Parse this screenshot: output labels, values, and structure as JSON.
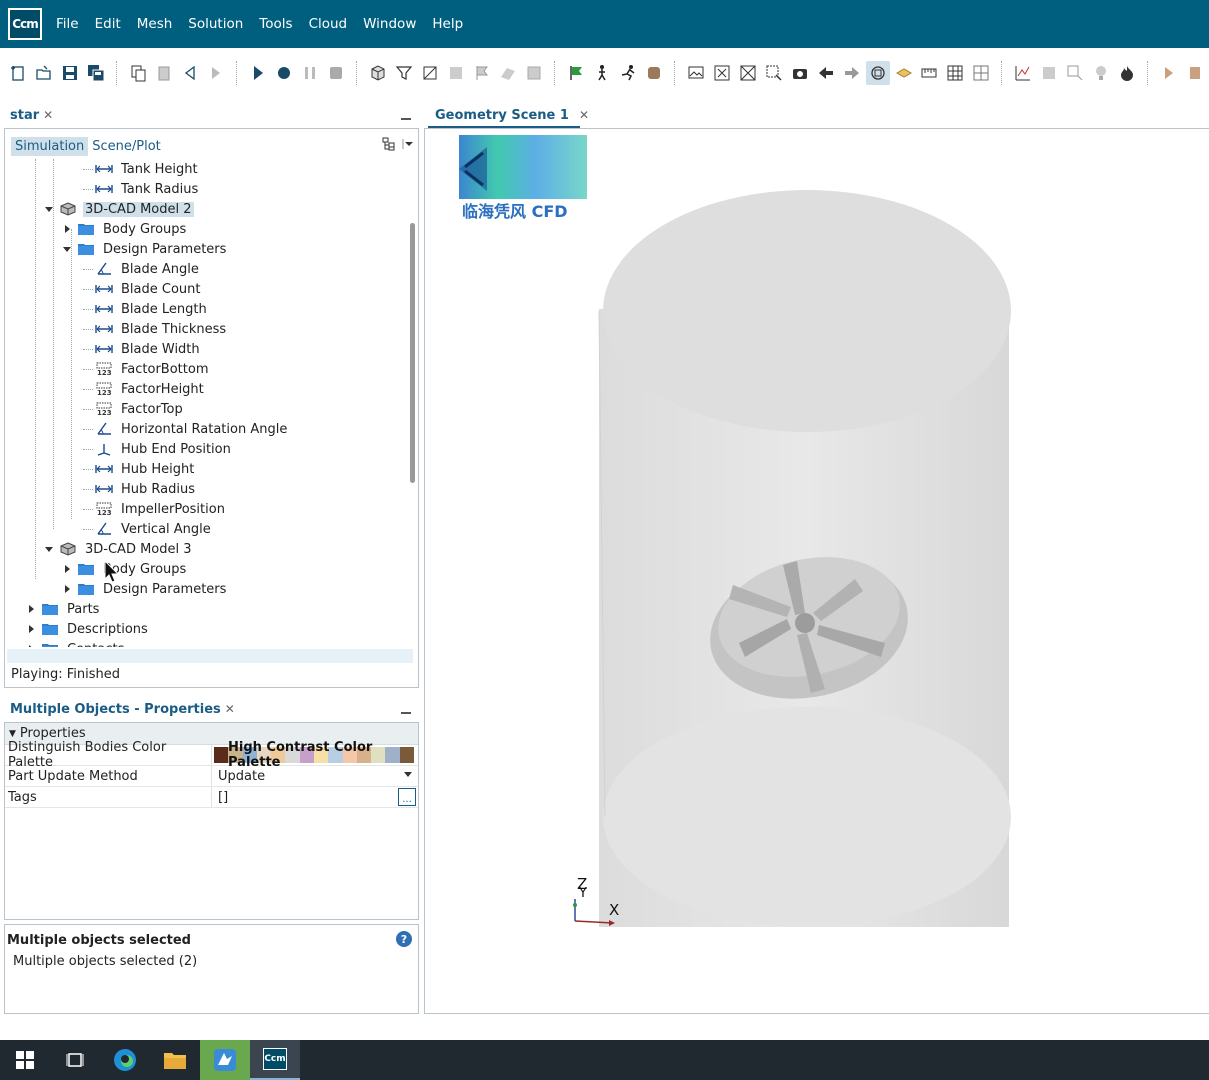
{
  "menubar": {
    "app_icon": "ccm-logo",
    "app_logo_text": "Ccm",
    "items": [
      "File",
      "Edit",
      "Mesh",
      "Solution",
      "Tools",
      "Cloud",
      "Window",
      "Help"
    ]
  },
  "toolbar": {
    "groups": [
      [
        "new-sim-icon",
        "open-icon",
        "save-icon",
        "save-all-icon"
      ],
      [
        "copy-icon",
        "clipboard-icon",
        "step-back-icon",
        "step-forward-icon"
      ],
      [
        "run-icon",
        "step-icon",
        "pause-icon",
        "stop-icon"
      ],
      [
        "mesh-icon",
        "filter-icon",
        "geometry-icon",
        "grid-icon",
        "flag-icon",
        "surface-icon",
        "volume-icon"
      ],
      [
        "green-flag-icon",
        "walk-icon",
        "run-man-icon",
        "cylinder-icon"
      ],
      [
        "screenshot-icon",
        "fit-icon",
        "zoom-icon",
        "select-icon",
        "camera-icon",
        "back-arrow-icon",
        "forward-arrow-icon",
        "transparency-icon",
        "plane-icon",
        "ruler-icon",
        "table-icon",
        "layout-icon"
      ],
      [
        "plot-icon",
        "pan-icon",
        "crop-icon",
        "bulb-icon",
        "fire-icon"
      ],
      [
        "play-icon",
        "more-icon"
      ]
    ]
  },
  "tree_panel": {
    "tab_title": "star",
    "subtabs": [
      "Simulation",
      "Scene/Plot"
    ],
    "active_subtab": "Simulation",
    "rows": [
      {
        "label": "Tank Height",
        "icon": "length-param-icon",
        "depth": 3
      },
      {
        "label": "Tank Radius",
        "icon": "length-param-icon",
        "depth": 3
      },
      {
        "label": "3D-CAD Model 2",
        "icon": "cad-model-icon",
        "depth": 1,
        "expanded": true,
        "highlight": true
      },
      {
        "label": "Body Groups",
        "icon": "folder-icon",
        "depth": 2,
        "expanded": false
      },
      {
        "label": "Design Parameters",
        "icon": "folder-icon",
        "depth": 2,
        "expanded": true
      },
      {
        "label": "Blade Angle",
        "icon": "angle-param-icon",
        "depth": 3
      },
      {
        "label": "Blade Count",
        "icon": "length-param-icon",
        "depth": 3
      },
      {
        "label": "Blade Length",
        "icon": "length-param-icon",
        "depth": 3
      },
      {
        "label": "Blade Thickness",
        "icon": "length-param-icon",
        "depth": 3
      },
      {
        "label": "Blade Width",
        "icon": "length-param-icon",
        "depth": 3
      },
      {
        "label": "FactorBottom",
        "icon": "number-param-icon",
        "depth": 3
      },
      {
        "label": "FactorHeight",
        "icon": "number-param-icon",
        "depth": 3
      },
      {
        "label": "FactorTop",
        "icon": "number-param-icon",
        "depth": 3
      },
      {
        "label": "Horizontal Ratation Angle",
        "icon": "angle-param-icon",
        "depth": 3
      },
      {
        "label": "Hub End Position",
        "icon": "vector-param-icon",
        "depth": 3
      },
      {
        "label": "Hub Height",
        "icon": "length-param-icon",
        "depth": 3
      },
      {
        "label": "Hub Radius",
        "icon": "length-param-icon",
        "depth": 3
      },
      {
        "label": "ImpellerPosition",
        "icon": "number-param-icon",
        "depth": 3
      },
      {
        "label": "Vertical Angle",
        "icon": "angle-param-icon",
        "depth": 3
      },
      {
        "label": "3D-CAD Model 3",
        "icon": "cad-model-icon",
        "depth": 1,
        "expanded": true
      },
      {
        "label": "Body Groups",
        "icon": "folder-icon",
        "depth": 2,
        "expanded": false
      },
      {
        "label": "Design Parameters",
        "icon": "folder-icon",
        "depth": 2,
        "expanded": false
      },
      {
        "label": "Parts",
        "icon": "folder-icon",
        "depth": 0,
        "expanded": false
      },
      {
        "label": "Descriptions",
        "icon": "folder-icon",
        "depth": 0,
        "expanded": false
      },
      {
        "label": "Contacts",
        "icon": "folder-icon",
        "depth": 0,
        "expanded": false
      }
    ],
    "status": "Playing: Finished"
  },
  "properties_panel": {
    "tab_title": "Multiple Objects - Properties",
    "section": "Properties",
    "rows": [
      {
        "name": "Distinguish Bodies Color Palette",
        "value": "High Contrast Color Palette",
        "kind": "palette"
      },
      {
        "name": "Part Update Method",
        "value": "Update",
        "kind": "dropdown"
      },
      {
        "name": "Tags",
        "value": "[]",
        "kind": "dots"
      }
    ],
    "palette_colors": [
      "#5a2a1a",
      "#c9b38a",
      "#8fb2d9",
      "#e8d6c0",
      "#f0c99a",
      "#d9d9d9",
      "#c7a0c9",
      "#f6e0a6",
      "#b8cfe3",
      "#f5c6a8",
      "#d6b18a",
      "#e0e0c0",
      "#9fb1c9",
      "#7a5a3a"
    ],
    "dots_label": "..."
  },
  "description_panel": {
    "title": "Multiple objects selected",
    "text": "Multiple objects selected (2)",
    "help": "?"
  },
  "scene_panel": {
    "tab_title": "Geometry Scene 1",
    "watermark_text": "临海凭风 CFD",
    "axis_labels": {
      "x": "X",
      "y": "Y",
      "z": "Z"
    }
  },
  "taskbar": {
    "items": [
      "windows-start-icon",
      "task-view-icon",
      "edge-browser-icon",
      "file-explorer-icon",
      "feishu-icon",
      "ccm-app-icon"
    ],
    "active_app_text": "Ccm"
  },
  "colors": {
    "menubar": "#005f7f",
    "accent": "#1a5c85",
    "selection": "#cfe0ea",
    "taskbar": "#202830"
  }
}
